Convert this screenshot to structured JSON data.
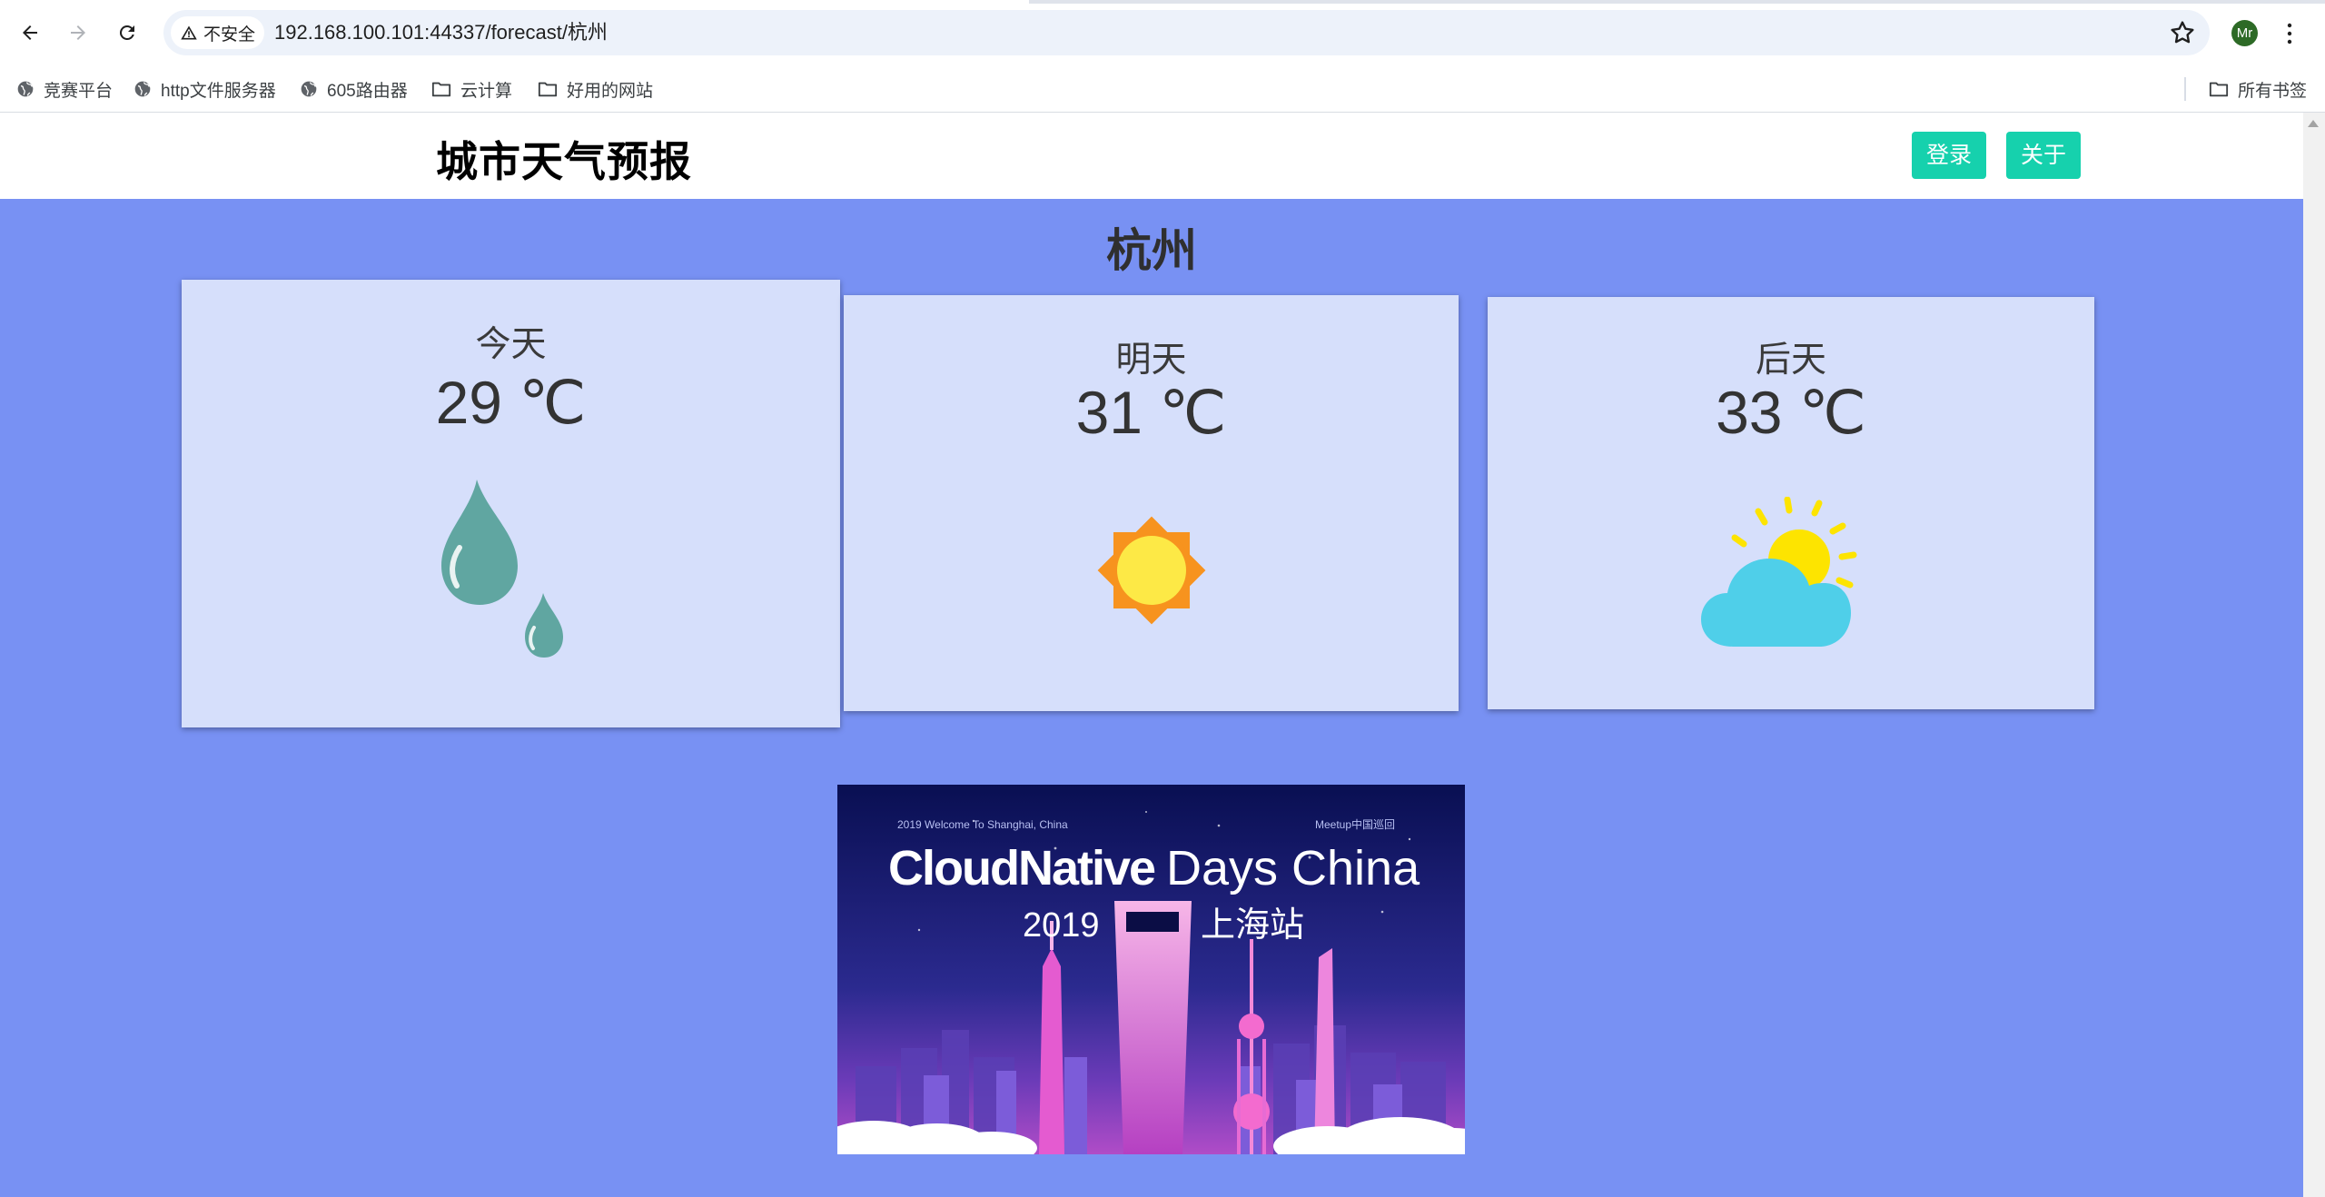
{
  "browser": {
    "security_label": "不安全",
    "url": "192.168.100.101:44337/forecast/杭州",
    "profile_initials": "Mr",
    "bookmarks": [
      {
        "label": "竞赛平台",
        "icon": "globe-icon"
      },
      {
        "label": "http文件服务器",
        "icon": "globe-icon"
      },
      {
        "label": "605路由器",
        "icon": "globe-icon"
      },
      {
        "label": "云计算",
        "icon": "folder-icon"
      },
      {
        "label": "好用的网站",
        "icon": "folder-icon"
      }
    ],
    "all_bookmarks_label": "所有书签"
  },
  "header": {
    "title": "城市天气预报",
    "login_label": "登录",
    "about_label": "关于",
    "button_color": "#16d1ad"
  },
  "city": "杭州",
  "forecast": [
    {
      "day": "今天",
      "temp": "29 ℃",
      "icon": "rain-drops-icon"
    },
    {
      "day": "明天",
      "temp": "31 ℃",
      "icon": "sun-icon"
    },
    {
      "day": "后天",
      "temp": "33 ℃",
      "icon": "partly-cloudy-icon"
    }
  ],
  "banner": {
    "tagline_left": "2019 Welcome To Shanghai, China",
    "tagline_right": "Meetup中国巡回",
    "brand_bold": "CloudNative",
    "brand_light": "Days China",
    "year": "2019",
    "station": "上海站"
  },
  "colors": {
    "page_background": "#7891f3",
    "card_background": "#d6dffb"
  }
}
